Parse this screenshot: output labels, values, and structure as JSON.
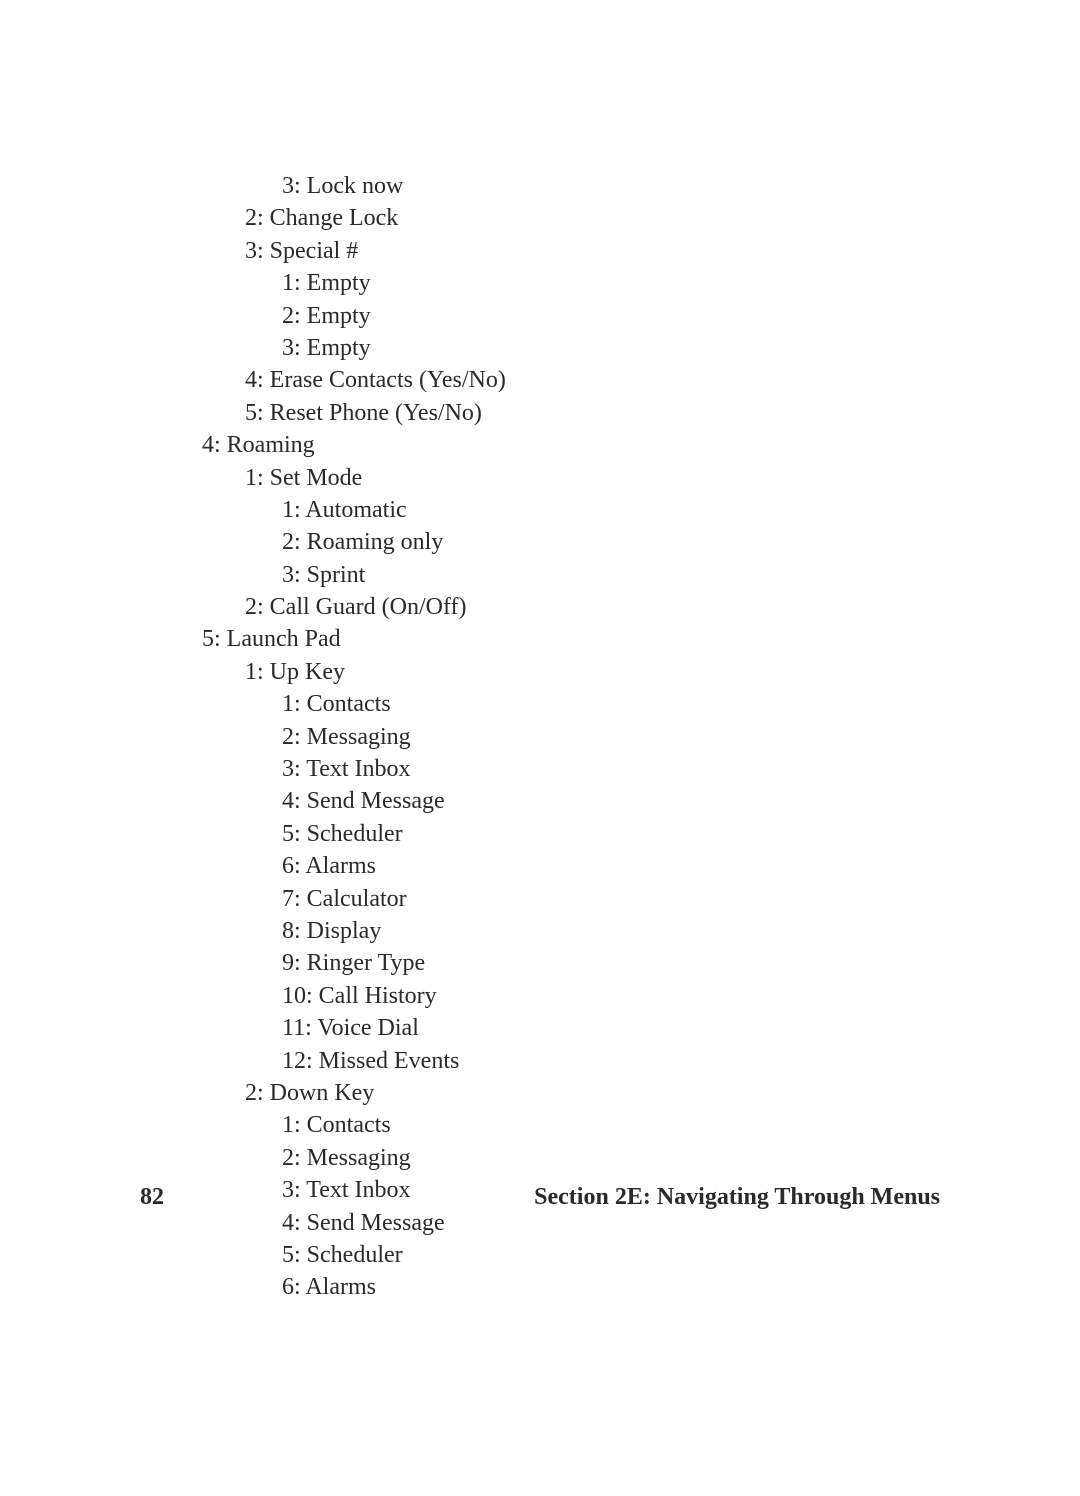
{
  "lines": [
    {
      "indent": 2,
      "text": "3: Lock now"
    },
    {
      "indent": 1,
      "text": "2: Change Lock"
    },
    {
      "indent": 1,
      "text": "3: Special #"
    },
    {
      "indent": 2,
      "text": "1: Empty"
    },
    {
      "indent": 2,
      "text": "2: Empty"
    },
    {
      "indent": 2,
      "text": "3: Empty"
    },
    {
      "indent": 1,
      "text": "4: Erase Contacts (Yes/No)"
    },
    {
      "indent": 1,
      "text": "5: Reset Phone (Yes/No)"
    },
    {
      "indent": 0,
      "text": "4: Roaming"
    },
    {
      "indent": 1,
      "text": "1: Set Mode"
    },
    {
      "indent": 2,
      "text": "1: Automatic"
    },
    {
      "indent": 2,
      "text": "2: Roaming only"
    },
    {
      "indent": 2,
      "text": "3: Sprint"
    },
    {
      "indent": 1,
      "text": "2: Call Guard (On/Off)"
    },
    {
      "indent": 0,
      "text": "5: Launch Pad"
    },
    {
      "indent": 1,
      "text": "1: Up Key"
    },
    {
      "indent": 2,
      "text": "1: Contacts"
    },
    {
      "indent": 2,
      "text": "2: Messaging"
    },
    {
      "indent": 2,
      "text": "3: Text Inbox"
    },
    {
      "indent": 2,
      "text": "4: Send Message"
    },
    {
      "indent": 2,
      "text": "5: Scheduler"
    },
    {
      "indent": 2,
      "text": "6: Alarms"
    },
    {
      "indent": 2,
      "text": "7: Calculator"
    },
    {
      "indent": 2,
      "text": "8: Display"
    },
    {
      "indent": 2,
      "text": "9: Ringer Type"
    },
    {
      "indent": 2,
      "text": "10: Call History"
    },
    {
      "indent": 2,
      "text": "11: Voice Dial"
    },
    {
      "indent": 2,
      "text": "12: Missed Events"
    },
    {
      "indent": 1,
      "text": "2: Down Key"
    },
    {
      "indent": 2,
      "text": "1: Contacts"
    },
    {
      "indent": 2,
      "text": "2: Messaging"
    },
    {
      "indent": 2,
      "text": "3: Text Inbox"
    },
    {
      "indent": 2,
      "text": "4: Send Message"
    },
    {
      "indent": 2,
      "text": "5: Scheduler"
    },
    {
      "indent": 2,
      "text": "6: Alarms"
    }
  ],
  "footer": {
    "page_number": "82",
    "section_title": "Section 2E: Navigating Through Menus"
  }
}
